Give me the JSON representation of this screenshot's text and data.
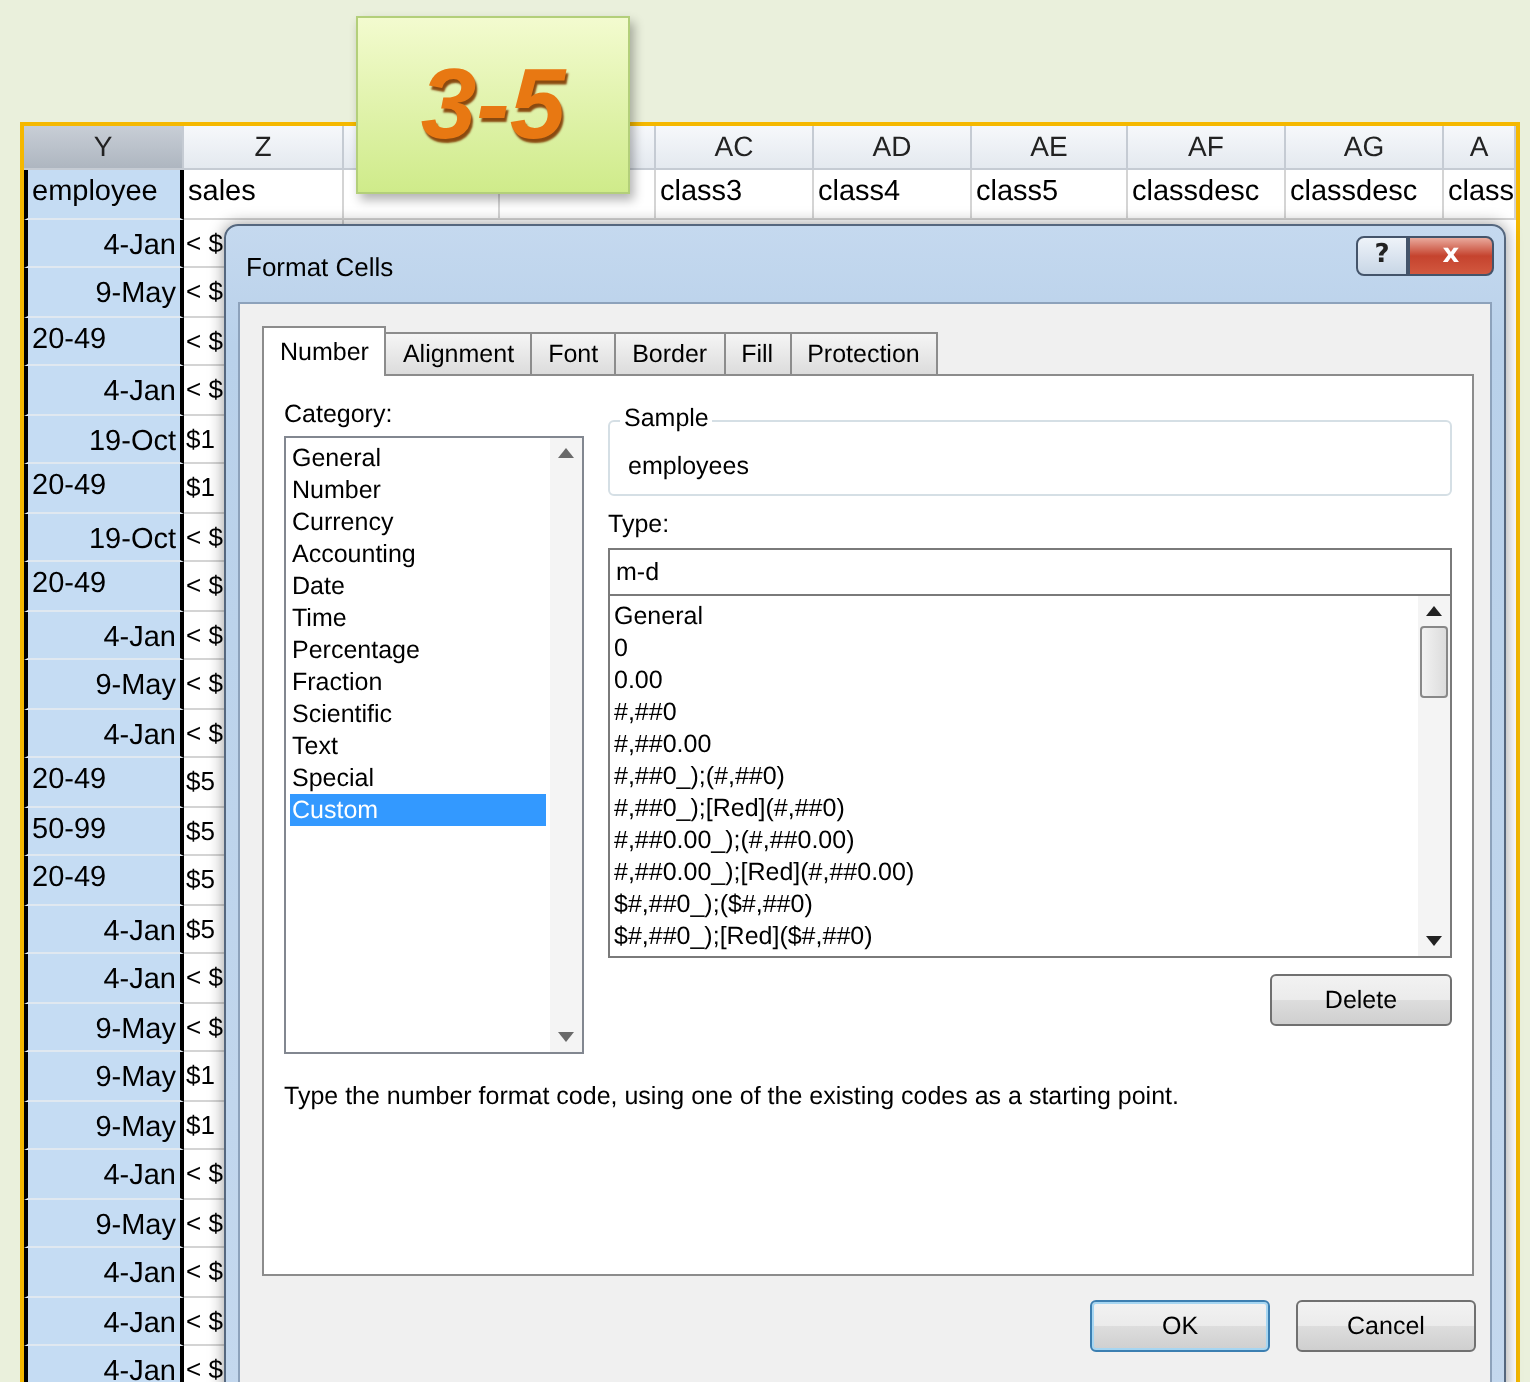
{
  "badge": "3-5",
  "sheet": {
    "columns": [
      {
        "label": "Y",
        "selected": true,
        "row1": "employee"
      },
      {
        "label": "Z",
        "selected": false,
        "row1": "sales"
      },
      {
        "label": "AC",
        "selected": false,
        "row1": "class3"
      },
      {
        "label": "AD",
        "selected": false,
        "row1": "class4"
      },
      {
        "label": "AE",
        "selected": false,
        "row1": "class5"
      },
      {
        "label": "AF",
        "selected": false,
        "row1": "classdesc"
      },
      {
        "label": "AG",
        "selected": false,
        "row1": "classdesc"
      },
      {
        "label": "A",
        "selected": false,
        "row1": "class"
      }
    ],
    "rows": [
      {
        "kind": "date",
        "y": "4-Jan",
        "z": "< $"
      },
      {
        "kind": "date",
        "y": "9-May",
        "z": "< $"
      },
      {
        "kind": "text",
        "y": "20-49",
        "z": "< $"
      },
      {
        "kind": "date",
        "y": "4-Jan",
        "z": "< $"
      },
      {
        "kind": "date",
        "y": "19-Oct",
        "z": "$1"
      },
      {
        "kind": "text",
        "y": "20-49",
        "z": "$1"
      },
      {
        "kind": "date",
        "y": "19-Oct",
        "z": "< $"
      },
      {
        "kind": "text",
        "y": "20-49",
        "z": "< $"
      },
      {
        "kind": "date",
        "y": "4-Jan",
        "z": "< $"
      },
      {
        "kind": "date",
        "y": "9-May",
        "z": "< $"
      },
      {
        "kind": "date",
        "y": "4-Jan",
        "z": "< $"
      },
      {
        "kind": "text",
        "y": "20-49",
        "z": "$5"
      },
      {
        "kind": "text",
        "y": "50-99",
        "z": "$5"
      },
      {
        "kind": "text",
        "y": "20-49",
        "z": "$5"
      },
      {
        "kind": "date",
        "y": "4-Jan",
        "z": "$5"
      },
      {
        "kind": "date",
        "y": "4-Jan",
        "z": "< $"
      },
      {
        "kind": "date",
        "y": "9-May",
        "z": "< $"
      },
      {
        "kind": "date",
        "y": "9-May",
        "z": "$1"
      },
      {
        "kind": "date",
        "y": "9-May",
        "z": "$1"
      },
      {
        "kind": "date",
        "y": "4-Jan",
        "z": "< $"
      },
      {
        "kind": "date",
        "y": "9-May",
        "z": "< $"
      },
      {
        "kind": "date",
        "y": "4-Jan",
        "z": "< $"
      },
      {
        "kind": "date",
        "y": "4-Jan",
        "z": "< $"
      },
      {
        "kind": "date",
        "y": "4-Jan",
        "z": "< $"
      }
    ]
  },
  "dialog": {
    "title": "Format Cells",
    "help": "?",
    "close": "x",
    "tabs": [
      {
        "label": "Number",
        "selected": true
      },
      {
        "label": "Alignment",
        "selected": false
      },
      {
        "label": "Font",
        "selected": false
      },
      {
        "label": "Border",
        "selected": false
      },
      {
        "label": "Fill",
        "selected": false
      },
      {
        "label": "Protection",
        "selected": false
      }
    ],
    "category_label": "Category:",
    "categories": [
      {
        "label": "General",
        "selected": false
      },
      {
        "label": "Number",
        "selected": false
      },
      {
        "label": "Currency",
        "selected": false
      },
      {
        "label": "Accounting",
        "selected": false
      },
      {
        "label": "Date",
        "selected": false
      },
      {
        "label": "Time",
        "selected": false
      },
      {
        "label": "Percentage",
        "selected": false
      },
      {
        "label": "Fraction",
        "selected": false
      },
      {
        "label": "Scientific",
        "selected": false
      },
      {
        "label": "Text",
        "selected": false
      },
      {
        "label": "Special",
        "selected": false
      },
      {
        "label": "Custom",
        "selected": true
      }
    ],
    "sample_label": "Sample",
    "sample_value": "employees",
    "type_label": "Type:",
    "type_value": "m-d",
    "type_list": [
      "General",
      "0",
      "0.00",
      "#,##0",
      "#,##0.00",
      "#,##0_);(#,##0)",
      "#,##0_);[Red](#,##0)",
      "#,##0.00_);(#,##0.00)",
      "#,##0.00_);[Red](#,##0.00)",
      "$#,##0_);($#,##0)",
      "$#,##0_);[Red]($#,##0)"
    ],
    "delete_button": "Delete",
    "hint": "Type the number format code, using one of the existing codes as a starting point.",
    "buttons": [
      "OK",
      "Cancel"
    ]
  }
}
